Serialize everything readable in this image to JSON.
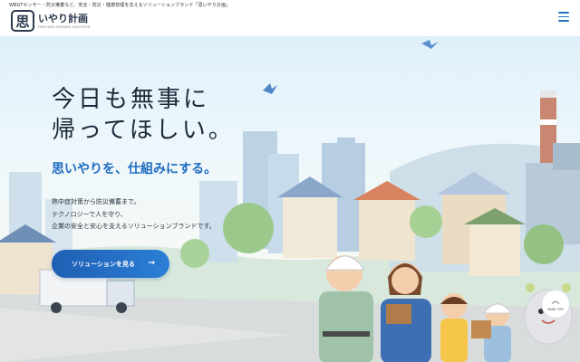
{
  "header": {
    "tagline": "WBGTセンサー・防災備蓄など、安全・防災・健康管理を支えるソリューションブランド「思いやり計画」",
    "logo_mark": "思",
    "logo_name": "いやり計画",
    "logo_sub": "OMOIYARI KEIKAKU SOLUTION"
  },
  "hero": {
    "headline_line1": "今日も無事に",
    "headline_line2": "帰ってほしい。",
    "subhead": "思いやりを、仕組みにする。",
    "body_lines": [
      "熱中症対策から防災備蓄まで。",
      "テクノロジーで人を守り、",
      "企業の安全と安心を支えるソリューションブランドです。"
    ],
    "cta_label": "ソリューションを見る",
    "cta_arrow": "→"
  },
  "page_top": {
    "chevron": "︿",
    "label": "PAGE TOP"
  },
  "colors": {
    "accent": "#1f6cc0",
    "cta": "#2b7fd6",
    "heading": "#1c2a3a",
    "menu": "#1e73be"
  },
  "icons": [
    "menu-icon",
    "arrow-right-icon",
    "chevron-up-icon"
  ]
}
